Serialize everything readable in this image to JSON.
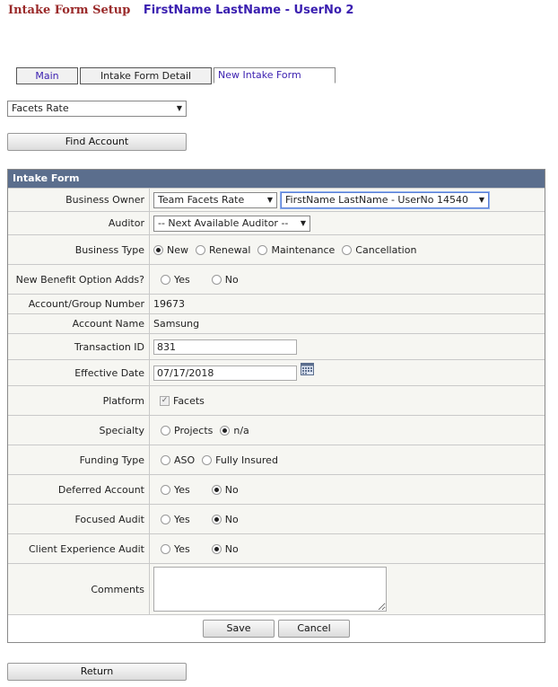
{
  "header": {
    "title": "Intake Form Setup",
    "user": "FirstName LastName - UserNo 2"
  },
  "tabs": [
    {
      "label": "Main"
    },
    {
      "label": "Intake Form Detail"
    },
    {
      "label": "New Intake Form"
    }
  ],
  "plan_select": {
    "value": "Facets Rate"
  },
  "find_account_label": "Find Account",
  "form": {
    "title": "Intake Form",
    "business_owner": {
      "label": "Business Owner",
      "team": "Team Facets Rate",
      "owner": "FirstName LastName - UserNo 14540"
    },
    "auditor": {
      "label": "Auditor",
      "value": "-- Next Available Auditor --"
    },
    "business_type": {
      "label": "Business Type",
      "options": [
        "New",
        "Renewal",
        "Maintenance",
        "Cancellation"
      ]
    },
    "benefit_adds": {
      "label": "New Benefit Option Adds?",
      "yes": "Yes",
      "no": "No"
    },
    "account_number": {
      "label": "Account/Group Number",
      "value": "19673"
    },
    "account_name": {
      "label": "Account Name",
      "value": "Samsung"
    },
    "transaction_id": {
      "label": "Transaction ID",
      "value": "831"
    },
    "effective_date": {
      "label": "Effective Date",
      "value": "07/17/2018"
    },
    "platform": {
      "label": "Platform",
      "value": "Facets"
    },
    "specialty": {
      "label": "Specialty",
      "opt1": "Projects",
      "opt2": "n/a"
    },
    "funding_type": {
      "label": "Funding Type",
      "opt1": "ASO",
      "opt2": "Fully Insured"
    },
    "deferred_account": {
      "label": "Deferred Account",
      "yes": "Yes",
      "no": "No"
    },
    "focused_audit": {
      "label": "Focused Audit",
      "yes": "Yes",
      "no": "No"
    },
    "client_experience": {
      "label": "Client Experience Audit",
      "yes": "Yes",
      "no": "No"
    },
    "comments": {
      "label": "Comments",
      "value": ""
    },
    "save_label": "Save",
    "cancel_label": "Cancel"
  },
  "return_label": "Return",
  "colors": {
    "header_title": "#9a2a2a",
    "header_user": "#3a1fb0",
    "form_title_bg": "#5b6e8d"
  }
}
